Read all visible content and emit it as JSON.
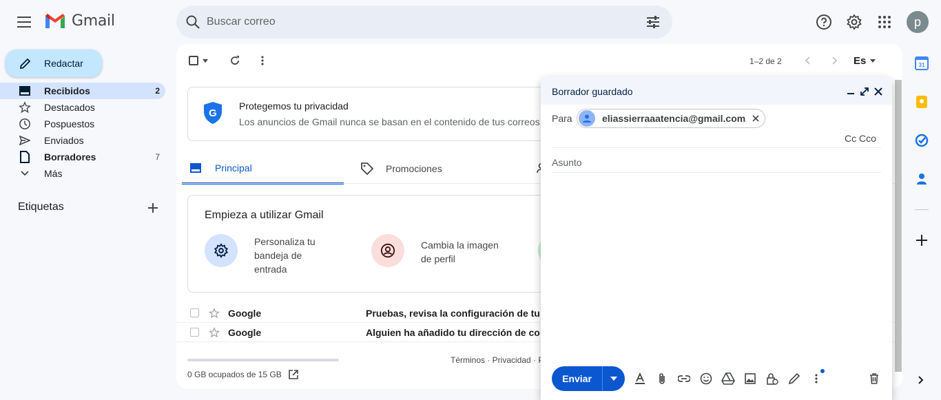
{
  "app": {
    "name": "Gmail"
  },
  "search": {
    "placeholder": "Buscar correo"
  },
  "header": {
    "avatar_letter": "p"
  },
  "compose_button": {
    "label": "Redactar"
  },
  "sidebar": {
    "items": [
      {
        "label": "Recibidos",
        "count": "2",
        "icon": "inbox-icon"
      },
      {
        "label": "Destacados",
        "count": "",
        "icon": "star-icon"
      },
      {
        "label": "Pospuestos",
        "count": "",
        "icon": "clock-icon"
      },
      {
        "label": "Enviados",
        "count": "",
        "icon": "send-icon"
      },
      {
        "label": "Borradores",
        "count": "7",
        "icon": "draft-icon"
      },
      {
        "label": "Más",
        "count": "",
        "icon": "chevron-down-icon"
      }
    ],
    "labels_title": "Etiquetas"
  },
  "toolbar": {
    "range": "1–2 de 2",
    "language": "Es"
  },
  "privacy_card": {
    "title": "Protegemos tu privacidad",
    "text": "Los anuncios de Gmail nunca se basan en el contenido de tus correos"
  },
  "tabs": [
    {
      "label": "Principal",
      "active": true
    },
    {
      "label": "Promociones",
      "active": false
    }
  ],
  "getting_started": {
    "title": "Empieza a utilizar Gmail",
    "items": [
      {
        "line1": "Personaliza tu",
        "line2": "bandeja de",
        "line3": "entrada"
      },
      {
        "line1": "Cambia la imagen",
        "line2": "de perfil"
      }
    ]
  },
  "messages": [
    {
      "sender": "Google",
      "subject": "Pruebas, revisa la configuración de tu"
    },
    {
      "sender": "Google",
      "subject": "Alguien ha añadido tu dirección de co"
    }
  ],
  "storage": {
    "text": "0 GB ocupados de 15 GB"
  },
  "footer": {
    "links": "Términos · Privacidad · P"
  },
  "compose": {
    "title": "Borrador guardado",
    "to_label": "Para",
    "recipient": "eliassierraaatencia@gmail.com",
    "cc_label": "Cc Cco",
    "subject_placeholder": "Asunto",
    "send_label": "Enviar"
  },
  "colors": {
    "accent": "#0b57d0",
    "compose_bg": "#c2e7ff",
    "active_nav": "#d3e3fd",
    "page_bg": "#f6f8fc"
  }
}
